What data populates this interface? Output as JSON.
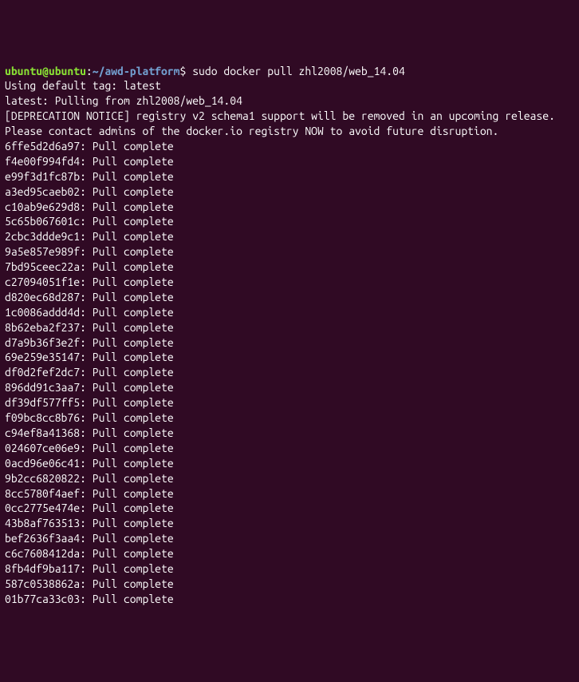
{
  "prompt": {
    "user_host": "ubuntu@ubuntu",
    "colon": ":",
    "path": "~/awd-platform",
    "dollar": "$ "
  },
  "command": "sudo docker pull zhl2008/web_14.04",
  "header_lines": [
    "Using default tag: latest",
    "latest: Pulling from zhl2008/web_14.04",
    "[DEPRECATION NOTICE] registry v2 schema1 support will be removed in an upcoming release. Please contact admins of the docker.io registry NOW to avoid future disruption."
  ],
  "pull_complete_lines": [
    "6ffe5d2d6a97: Pull complete",
    "f4e00f994fd4: Pull complete",
    "e99f3d1fc87b: Pull complete",
    "a3ed95caeb02: Pull complete",
    "c10ab9e629d8: Pull complete",
    "5c65b067601c: Pull complete",
    "2cbc3ddde9c1: Pull complete",
    "9a5e857e989f: Pull complete",
    "7bd95ceec22a: Pull complete",
    "c27094051f1e: Pull complete",
    "d820ec68d287: Pull complete",
    "1c0086addd4d: Pull complete",
    "8b62eba2f237: Pull complete",
    "d7a9b36f3e2f: Pull complete",
    "69e259e35147: Pull complete",
    "df0d2fef2dc7: Pull complete",
    "896dd91c3aa7: Pull complete",
    "df39df577ff5: Pull complete",
    "f09bc8cc8b76: Pull complete",
    "c94ef8a41368: Pull complete",
    "024607ce06e9: Pull complete",
    "0acd96e06c41: Pull complete",
    "9b2cc6820822: Pull complete",
    "8cc5780f4aef: Pull complete",
    "0cc2775e474e: Pull complete",
    "43b8af763513: Pull complete",
    "bef2636f3aa4: Pull complete",
    "c6c7608412da: Pull complete",
    "8fb4df9ba117: Pull complete",
    "587c0538862a: Pull complete",
    "01b77ca33c03: Pull complete"
  ]
}
